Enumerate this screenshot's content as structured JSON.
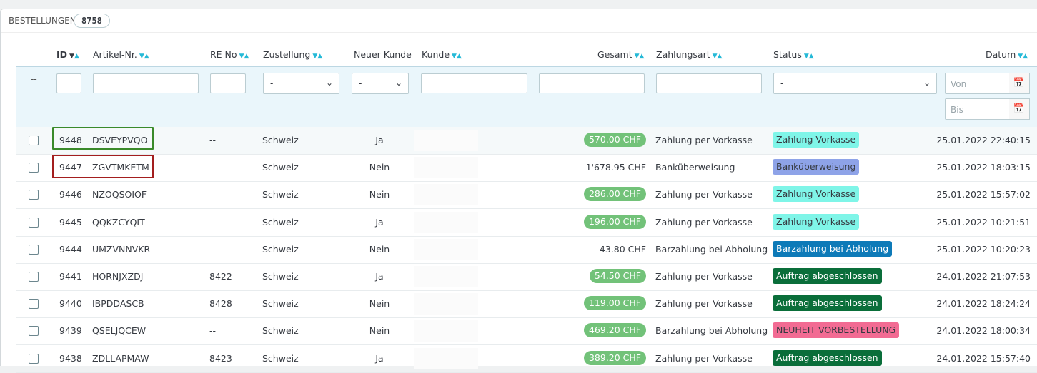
{
  "heading": {
    "title": "BESTELLUNGEN",
    "count": "8758"
  },
  "columns": {
    "id": "ID",
    "artikel": "Artikel-Nr.",
    "re_no": "RE No",
    "zustellung": "Zustellung",
    "neuer_kunde": "Neuer Kunde",
    "kunde": "Kunde",
    "gesamt": "Gesamt",
    "zahlungsart": "Zahlungsart",
    "status": "Status",
    "datum": "Datum"
  },
  "filters": {
    "bulk_dash": "--",
    "zustellung_value": "-",
    "neuer_kunde_value": "-",
    "status_value": "-",
    "date_from_placeholder": "Von",
    "date_to_placeholder": "Bis"
  },
  "orders": [
    {
      "id": "9448",
      "artikel": "DSVEYPVQO",
      "re_no": "--",
      "zustellung": "Schweiz",
      "neuer_kunde": "Ja",
      "gesamt": "570.00 CHF",
      "gesamt_pill": true,
      "zahlungsart": "Zahlung per Vorkasse",
      "status": "Zahlung Vorkasse",
      "status_bg": "#7ff5e8",
      "status_fg": "#363a41",
      "datum": "25.01.2022 22:40:15"
    },
    {
      "id": "9447",
      "artikel": "ZGVTMKETM",
      "re_no": "--",
      "zustellung": "Schweiz",
      "neuer_kunde": "Nein",
      "gesamt": "1'678.95 CHF",
      "gesamt_pill": false,
      "zahlungsart": "Banküberweisung",
      "status": "Banküberweisung",
      "status_bg": "#8ea3e8",
      "status_fg": "#363a41",
      "datum": "25.01.2022 18:03:15"
    },
    {
      "id": "9446",
      "artikel": "NZOQSOIOF",
      "re_no": "--",
      "zustellung": "Schweiz",
      "neuer_kunde": "Nein",
      "gesamt": "286.00 CHF",
      "gesamt_pill": true,
      "zahlungsart": "Zahlung per Vorkasse",
      "status": "Zahlung Vorkasse",
      "status_bg": "#7ff5e8",
      "status_fg": "#363a41",
      "datum": "25.01.2022 15:57:02"
    },
    {
      "id": "9445",
      "artikel": "QQKZCYQIT",
      "re_no": "--",
      "zustellung": "Schweiz",
      "neuer_kunde": "Ja",
      "gesamt": "196.00 CHF",
      "gesamt_pill": true,
      "zahlungsart": "Zahlung per Vorkasse",
      "status": "Zahlung Vorkasse",
      "status_bg": "#7ff5e8",
      "status_fg": "#363a41",
      "datum": "25.01.2022 10:21:51"
    },
    {
      "id": "9444",
      "artikel": "UMZVNNVKR",
      "re_no": "--",
      "zustellung": "Schweiz",
      "neuer_kunde": "Nein",
      "gesamt": "43.80 CHF",
      "gesamt_pill": false,
      "zahlungsart": "Barzahlung bei Abholung",
      "status": "Barzahlung bei Abholung",
      "status_bg": "#0d7ab8",
      "status_fg": "#ffffff",
      "datum": "25.01.2022 10:20:23"
    },
    {
      "id": "9441",
      "artikel": "HORNJXZDJ",
      "re_no": "8422",
      "zustellung": "Schweiz",
      "neuer_kunde": "Ja",
      "gesamt": "54.50 CHF",
      "gesamt_pill": true,
      "zahlungsart": "Zahlung per Vorkasse",
      "status": "Auftrag abgeschlossen",
      "status_bg": "#0a6e3a",
      "status_fg": "#ffffff",
      "datum": "24.01.2022 21:07:53"
    },
    {
      "id": "9440",
      "artikel": "IBPDDASCB",
      "re_no": "8428",
      "zustellung": "Schweiz",
      "neuer_kunde": "Nein",
      "gesamt": "119.00 CHF",
      "gesamt_pill": true,
      "zahlungsart": "Zahlung per Vorkasse",
      "status": "Auftrag abgeschlossen",
      "status_bg": "#0a6e3a",
      "status_fg": "#ffffff",
      "datum": "24.01.2022 18:24:24"
    },
    {
      "id": "9439",
      "artikel": "QSELJQCEW",
      "re_no": "--",
      "zustellung": "Schweiz",
      "neuer_kunde": "Nein",
      "gesamt": "469.20 CHF",
      "gesamt_pill": true,
      "zahlungsart": "Barzahlung bei Abholung",
      "status": "NEUHEIT VORBESTELLUNG",
      "status_bg": "#f26b93",
      "status_fg": "#363a41",
      "datum": "24.01.2022 18:00:34"
    },
    {
      "id": "9438",
      "artikel": "ZDLLAPMAW",
      "re_no": "8423",
      "zustellung": "Schweiz",
      "neuer_kunde": "Ja",
      "gesamt": "389.20 CHF",
      "gesamt_pill": true,
      "zahlungsart": "Zahlung per Vorkasse",
      "status": "Auftrag abgeschlossen",
      "status_bg": "#0a6e3a",
      "status_fg": "#ffffff",
      "datum": "24.01.2022 15:57:40"
    }
  ],
  "highlights": {
    "green_row": "9448",
    "red_row": "9447",
    "green_color": "#3a8a2a",
    "red_color": "#a31e1e"
  },
  "icons": {
    "sort_asc": "triangle-up",
    "sort_desc": "triangle-down",
    "calendar": "calendar-icon",
    "select_chevron": "chevron-down-icon"
  }
}
